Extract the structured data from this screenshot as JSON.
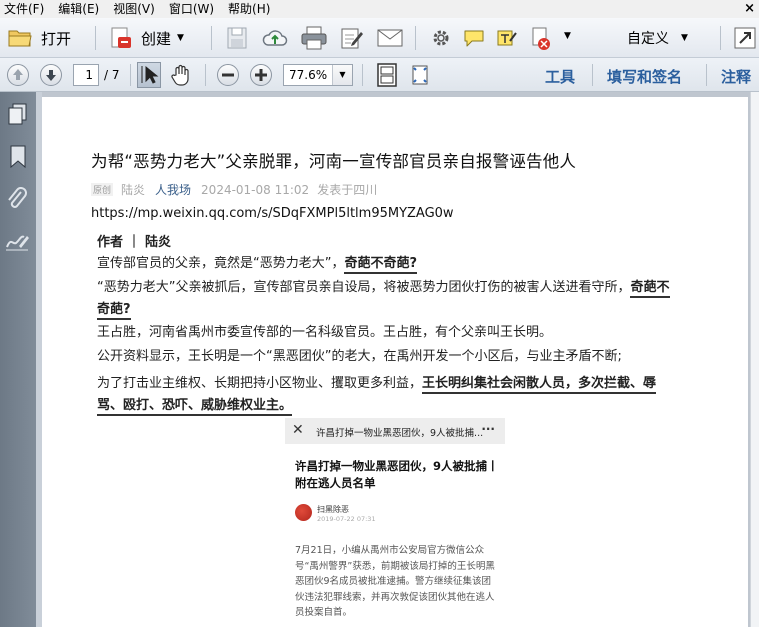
{
  "menu": [
    "文件(F)",
    "编辑(E)",
    "视图(V)",
    "窗口(W)",
    "帮助(H)"
  ],
  "toolbar1": {
    "open_label": "打开",
    "create_label": "创建",
    "customize_label": "自定义"
  },
  "toolbar2": {
    "page_current": "1",
    "page_total": "/ 7",
    "zoom": "77.6%",
    "tools_label": "工具",
    "fill_sign_label": "填写和签名",
    "comment_label": "注释"
  },
  "article": {
    "title": "为帮“恶势力老大”父亲脱罪，河南一宣传部官员亲自报警诬告他人",
    "tag": "原创",
    "author": "陆炎",
    "account": "人我场",
    "time": "2024-01-08 11:02",
    "location": "发表于四川",
    "url": "https://mp.weixin.qq.com/s/SDqFXMPl5ltlm95MYZAG0w",
    "byline": "作者 ｜ 陆炎",
    "p1_text": "宣传部官员的父亲，竟然是“恶势力老大”，",
    "p1_hl": "奇葩不奇葩?",
    "p2_text": "“恶势力老大”父亲被抓后，宣传部官员亲自设局，将被恶势力团伙打伤的被害人送进看守所，",
    "p2_hl_a": "奇葩不",
    "p2_hl_b": "奇葩?",
    "p3": "王占胜，河南省禹州市委宣传部的一名科级官员。王占胜，有个父亲叫王长明。",
    "p4": "公开资料显示，王长明是一个“黑恶团伙”的老大，在禹州开发一个小区后，与业主矛盾不断;",
    "p5_text": "为了打击业主维权、长期把持小区物业、攫取更多利益，",
    "p5_hl_a": "王长明纠集社会闲散人员，多次拦截、辱",
    "p5_hl_b": "骂、殴打、恐吓、威胁维权业主。"
  },
  "embed": {
    "bar_title": "许昌打掉一物业黑恶团伙，9人被批捕...",
    "title": "许昌打掉一物业黑恶团伙，9人被批捕丨附在逃人员名单",
    "source": "扫黑除恶",
    "source_time": "2019-07-22 07:31",
    "body": "7月21日，小编从禹州市公安局官方微信公众号“禹州警界”获悉，前期被该局打掉的王长明黑恶团伙9名成员被批准逮捕。警方继续征集该团伙违法犯罪线索，并再次敦促该团伙其他在逃人员投案自首。"
  }
}
